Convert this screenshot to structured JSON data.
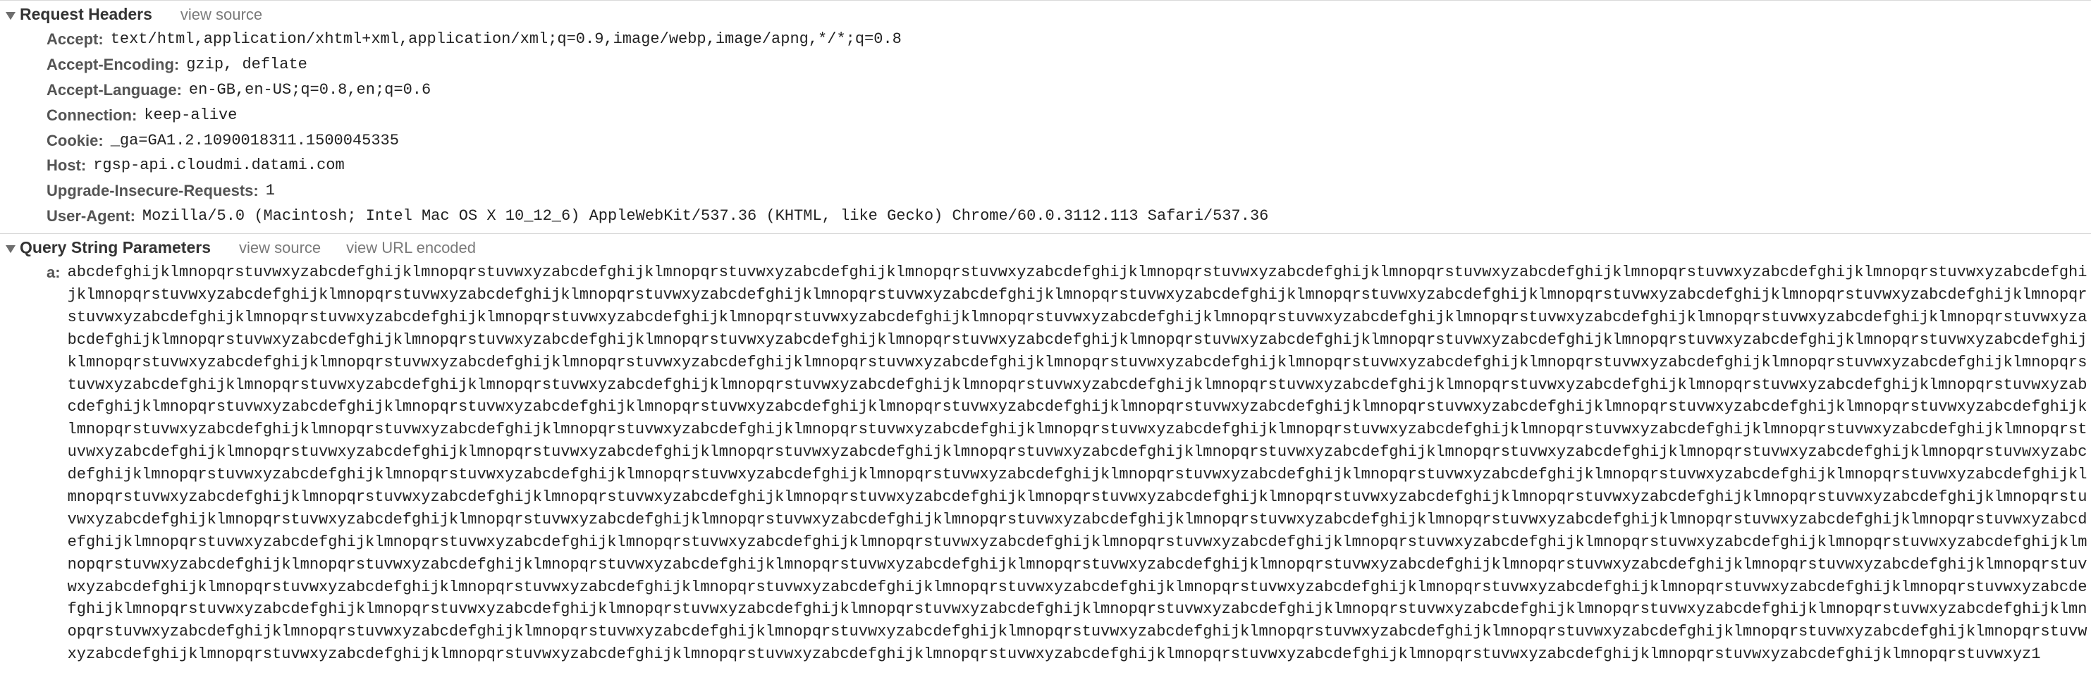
{
  "requestHeaders": {
    "title": "Request Headers",
    "viewSource": "view source",
    "rows": [
      {
        "key": "Accept",
        "value": "text/html,application/xhtml+xml,application/xml;q=0.9,image/webp,image/apng,*/*;q=0.8"
      },
      {
        "key": "Accept-Encoding",
        "value": "gzip, deflate"
      },
      {
        "key": "Accept-Language",
        "value": "en-GB,en-US;q=0.8,en;q=0.6"
      },
      {
        "key": "Connection",
        "value": "keep-alive"
      },
      {
        "key": "Cookie",
        "value": "_ga=GA1.2.1090018311.1500045335"
      },
      {
        "key": "Host",
        "value": "rgsp-api.cloudmi.datami.com"
      },
      {
        "key": "Upgrade-Insecure-Requests",
        "value": "1"
      },
      {
        "key": "User-Agent",
        "value": "Mozilla/5.0 (Macintosh; Intel Mac OS X 10_12_6) AppleWebKit/537.36 (KHTML, like Gecko) Chrome/60.0.3112.113 Safari/537.36"
      }
    ]
  },
  "queryString": {
    "title": "Query String Parameters",
    "viewSource": "view source",
    "viewUrlEncoded": "view URL encoded",
    "rows": [
      {
        "key": "a",
        "value": "abcdefghijklmnopqrstuvwxyzabcdefghijklmnopqrstuvwxyzabcdefghijklmnopqrstuvwxyzabcdefghijklmnopqrstuvwxyzabcdefghijklmnopqrstuvwxyzabcdefghijklmnopqrstuvwxyzabcdefghijklmnopqrstuvwxyzabcdefghijklmnopqrstuvwxyzabcdefghijklmnopqrstuvwxyzabcdefghijklmnopqrstuvwxyzabcdefghijklmnopqrstuvwxyzabcdefghijklmnopqrstuvwxyzabcdefghijklmnopqrstuvwxyzabcdefghijklmnopqrstuvwxyzabcdefghijklmnopqrstuvwxyzabcdefghijklmnopqrstuvwxyzabcdefghijklmnopqrstuvwxyzabcdefghijklmnopqrstuvwxyzabcdefghijklmnopqrstuvwxyzabcdefghijklmnopqrstuvwxyzabcdefghijklmnopqrstuvwxyzabcdefghijklmnopqrstuvwxyzabcdefghijklmnopqrstuvwxyzabcdefghijklmnopqrstuvwxyzabcdefghijklmnopqrstuvwxyzabcdefghijklmnopqrstuvwxyzabcdefghijklmnopqrstuvwxyzabcdefghijklmnopqrstuvwxyzabcdefghijklmnopqrstuvwxyzabcdefghijklmnopqrstuvwxyzabcdefghijklmnopqrstuvwxyzabcdefghijklmnopqrstuvwxyzabcdefghijklmnopqrstuvwxyzabcdefghijklmnopqrstuvwxyzabcdefghijklmnopqrstuvwxyzabcdefghijklmnopqrstuvwxyzabcdefghijklmnopqrstuvwxyzabcdefghijklmnopqrstuvwxyzabcdefghijklmnopqrstuvwxyzabcdefghijklmnopqrstuvwxyzabcdefghijklmnopqrstuvwxyzabcdefghijklmnopqrstuvwxyzabcdefghijklmnopqrstuvwxyzabcdefghijklmnopqrstuvwxyzabcdefghijklmnopqrstuvwxyzabcdefghijklmnopqrstuvwxyzabcdefghijklmnopqrstuvwxyzabcdefghijklmnopqrstuvwxyzabcdefghijklmnopqrstuvwxyzabcdefghijklmnopqrstuvwxyzabcdefghijklmnopqrstuvwxyzabcdefghijklmnopqrstuvwxyzabcdefghijklmnopqrstuvwxyzabcdefghijklmnopqrstuvwxyzabcdefghijklmnopqrstuvwxyzabcdefghijklmnopqrstuvwxyzabcdefghijklmnopqrstuvwxyzabcdefghijklmnopqrstuvwxyzabcdefghijklmnopqrstuvwxyzabcdefghijklmnopqrstuvwxyzabcdefghijklmnopqrstuvwxyzabcdefghijklmnopqrstuvwxyzabcdefghijklmnopqrstuvwxyzabcdefghijklmnopqrstuvwxyzabcdefghijklmnopqrstuvwxyzabcdefghijklmnopqrstuvwxyzabcdefghijklmnopqrstuvwxyzabcdefghijklmnopqrstuvwxyzabcdefghijklmnopqrstuvwxyzabcdefghijklmnopqrstuvwxyzabcdefghijklmnopqrstuvwxyzabcdefghijklmnopqrstuvwxyzabcdefghijklmnopqrstuvwxyzabcdefghijklmnopqrstuvwxyzabcdefghijklmnopqrstuvwxyzabcdefghijklmnopqrstuvwxyzabcdefghijklmnopqrstuvwxyzabcdefghijklmnopqrstuvwxyzabcdefghijklmnopqrstuvwxyzabcdefghijklmnopqrstuvwxyzabcdefghijklmnopqrstuvwxyzabcdefghijklmnopqrstuvwxyzabcdefghijklmnopqrstuvwxyzabcdefghijklmnopqrstuvwxyzabcdefghijklmnopqrstuvwxyzabcdefghijklmnopqrstuvwxyzabcdefghijklmnopqrstuvwxyzabcdefghijklmnopqrstuvwxyzabcdefghijklmnopqrstuvwxyzabcdefghijklmnopqrstuvwxyzabcdefghijklmnopqrstuvwxyzabcdefghijklmnopqrstuvwxyzabcdefghijklmnopqrstuvwxyzabcdefghijklmnopqrstuvwxyzabcdefghijklmnopqrstuvwxyzabcdefghijklmnopqrstuvwxyzabcdefghijklmnopqrstuvwxyzabcdefghijklmnopqrstuvwxyzabcdefghijklmnopqrstuvwxyzabcdefghijklmnopqrstuvwxyzabcdefghijklmnopqrstuvwxyzabcdefghijklmnopqrstuvwxyzabcdefghijklmnopqrstuvwxyzabcdefghijklmnopqrstuvwxyzabcdefghijklmnopqrstuvwxyzabcdefghijklmnopqrstuvwxyzabcdefghijklmnopqrstuvwxyzabcdefghijklmnopqrstuvwxyzabcdefghijklmnopqrstuvwxyzabcdefghijklmnopqrstuvwxyzabcdefghijklmnopqrstuvwxyzabcdefghijklmnopqrstuvwxyzabcdefghijklmnopqrstuvwxyzabcdefghijklmnopqrstuvwxyzabcdefghijklmnopqrstuvwxyzabcdefghijklmnopqrstuvwxyzabcdefghijklmnopqrstuvwxyzabcdefghijklmnopqrstuvwxyzabcdefghijklmnopqrstuvwxyzabcdefghijklmnopqrstuvwxyzabcdefghijklmnopqrstuvwxyzabcdefghijklmnopqrstuvwxyzabcdefghijklmnopqrstuvwxyzabcdefghijklmnopqrstuvwxyzabcdefghijklmnopqrstuvwxyzabcdefghijklmnopqrstuvwxyzabcdefghijklmnopqrstuvwxyzabcdefghijklmnopqrstuvwxyzabcdefghijklmnopqrstuvwxyzabcdefghijklmnopqrstuvwxyzabcdefghijklmnopqrstuvwxyzabcdefghijklmnopqrstuvwxyzabcdefghijklmnopqrstuvwxyzabcdefghijklmnopqrstuvwxyzabcdefghijklmnopqrstuvwxyzabcdefghijklmnopqrstuvwxyzabcdefghijklmnopqrstuvwxyzabcdefghijklmnopqrstuvwxyzabcdefghijklmnopqrstuvwxyzabcdefghijklmnopqrstuvwxyzabcdefghijklmnopqrstuvwxyzabcdefghijklmnopqrstuvwxyzabcdefghijklmnopqrstuvwxyzabcdefghijklmnopqrstuvwxyzabcdefghijklmnopqrstuvwxyzabcdefghijklmnopqrstuvwxyzabcdefghijklmnopqrstuvwxyzabcdefghijklmnopqrstuvwxyzabcdefghijklmnopqrstuvwxyzabcdefghijklmnopqrstuvwxyz1"
      }
    ]
  }
}
